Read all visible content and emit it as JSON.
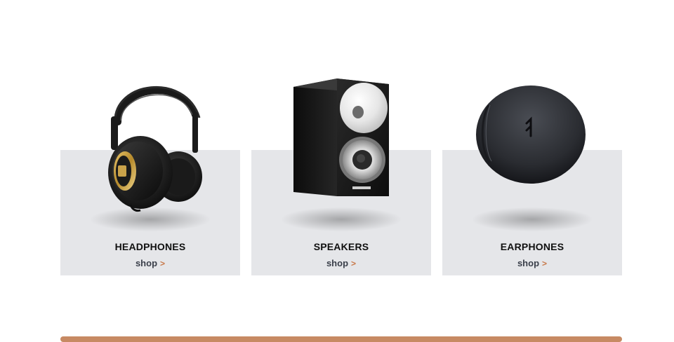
{
  "categories": [
    {
      "title": "HEADPHONES",
      "link_label": "shop",
      "link_chevron": ">"
    },
    {
      "title": "SPEAKERS",
      "link_label": "shop",
      "link_chevron": ">"
    },
    {
      "title": "EARPHONES",
      "link_label": "shop",
      "link_chevron": ">"
    }
  ],
  "colors": {
    "card_background": "#e5e6e9",
    "chevron_accent": "#c8794a",
    "bottom_bar": "#c78a63",
    "link_text": "#3a3f4a"
  },
  "icons": {
    "headphones": "headphones-image",
    "speakers": "speaker-image",
    "earphones": "earphones-case-image"
  }
}
